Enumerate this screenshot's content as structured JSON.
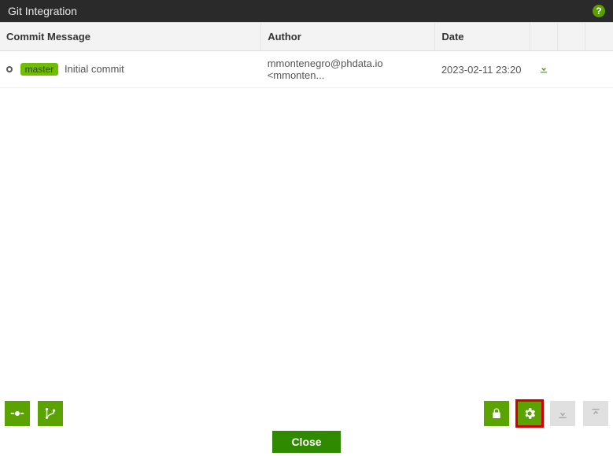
{
  "titlebar": {
    "title": "Git Integration"
  },
  "table": {
    "headers": {
      "commit_message": "Commit Message",
      "author": "Author",
      "date": "Date"
    },
    "rows": [
      {
        "branch": "master",
        "message": "Initial commit",
        "author": "mmontenegro@phdata.io <mmonten...",
        "date": "2023-02-11 23:20"
      }
    ]
  },
  "footer": {
    "close": "Close"
  },
  "icons": {
    "help": "?",
    "commit": "commit-icon",
    "branch": "branch-icon",
    "lock": "lock-icon",
    "settings": "gear-icon",
    "pull": "download-icon",
    "push": "upload-icon"
  },
  "colors": {
    "accent": "#5aa300",
    "branch_badge": "#6fbf00",
    "highlight": "#d40000",
    "titlebar": "#2a2a2a"
  }
}
